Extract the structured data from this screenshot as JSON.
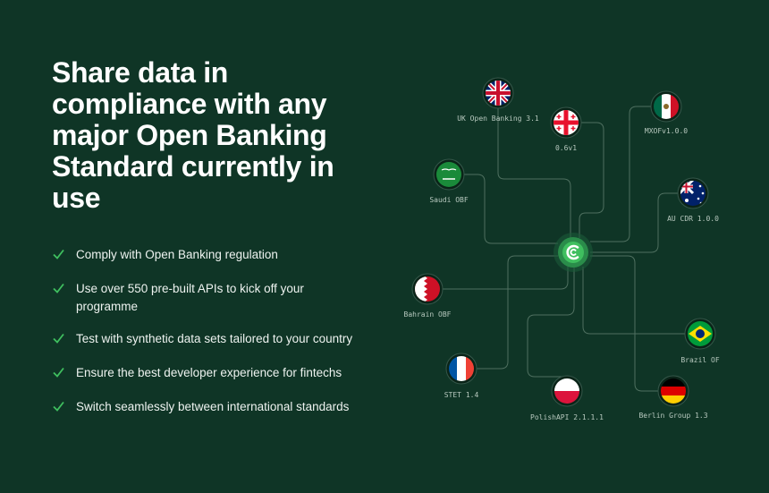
{
  "headline": "Share data in\ncompliance with any\nmajor Open Banking\nStandard currently in\nuse",
  "features": [
    "Comply with Open Banking regulation",
    "Use over 550 pre-built APIs to kick off your programme",
    "Test with synthetic data sets tailored to your country",
    "Ensure the best developer experience for fintechs",
    "Switch seamlessly between international standards"
  ],
  "standards": {
    "uk": "UK Open Banking 3.1",
    "georgia": "0.6v1",
    "mexico": "MXOFv1.0.0",
    "saudi": "Saudi OBF",
    "australia": "AU CDR 1.0.0",
    "bahrain": "Bahrain OBF",
    "brazil": "Brazil OF",
    "france": "STET 1.4",
    "poland": "PolishAPI 2.1.1.1",
    "germany": "Berlin Group 1.3"
  },
  "colors": {
    "background": "#0f3526",
    "accent": "#3fbf5f",
    "line": "#4f7060"
  }
}
